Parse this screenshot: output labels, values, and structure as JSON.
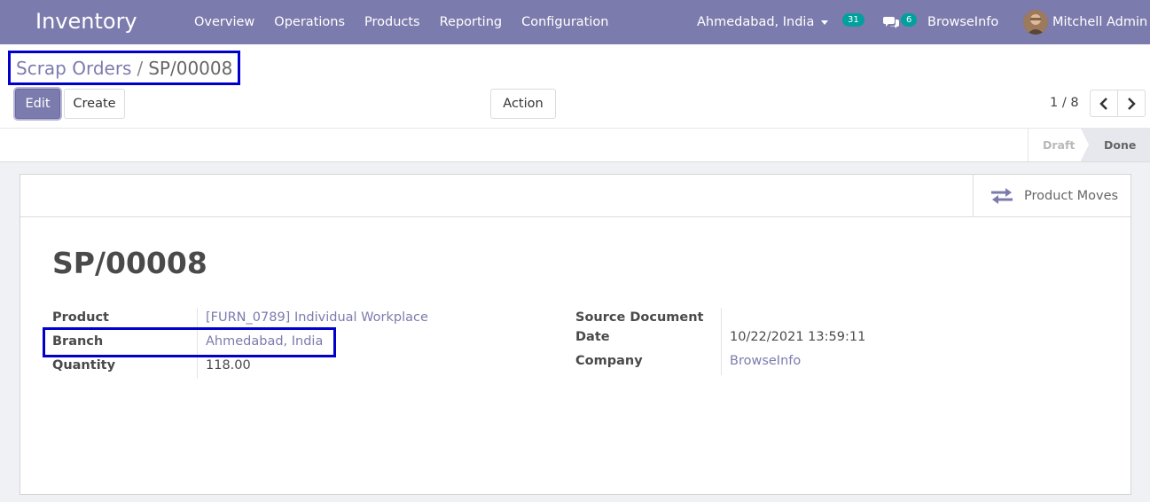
{
  "navbar": {
    "app_name": "Inventory",
    "menu": [
      "Overview",
      "Operations",
      "Products",
      "Reporting",
      "Configuration"
    ],
    "branch": "Ahmedabad, India",
    "activity_count": "31",
    "message_count": "6",
    "company": "BrowseInfo",
    "user": "Mitchell Admin"
  },
  "breadcrumb": {
    "parent": "Scrap Orders",
    "separator": "/",
    "current": "SP/00008"
  },
  "buttons": {
    "edit": "Edit",
    "create": "Create",
    "action": "Action"
  },
  "pager": {
    "value": "1 / 8"
  },
  "status": {
    "draft": "Draft",
    "done": "Done"
  },
  "smart_button": {
    "label": "Product Moves"
  },
  "form": {
    "title": "SP/00008",
    "left": {
      "product_label": "Product",
      "product_value": "[FURN_0789] Individual Workplace",
      "branch_label": "Branch",
      "branch_value": "Ahmedabad, India",
      "quantity_label": "Quantity",
      "quantity_value": "118.00"
    },
    "right": {
      "source_label": "Source Document",
      "date_label": "Date",
      "date_value": "10/22/2021 13:59:11",
      "company_label": "Company",
      "company_value": "BrowseInfo"
    }
  },
  "colors": {
    "navbar": "#7c7bad",
    "link": "#7c7bad",
    "badge": "#00a09d",
    "highlight": "#0000cc"
  }
}
